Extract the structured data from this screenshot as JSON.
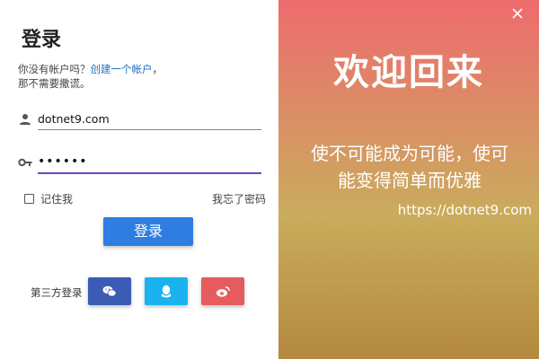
{
  "login": {
    "title": "登录",
    "hint_prefix": "你没有帐户吗？",
    "hint_link": "创建一个帐户",
    "hint_suffix": "，",
    "hint_line2": "那不需要撒谎。",
    "username_value": "dotnet9.com",
    "password_value": "••••••",
    "remember_label": "记住我",
    "forgot_label": "我忘了密码",
    "login_button": "登录",
    "third_party_label": "第三方登录",
    "social": [
      {
        "name": "wechat",
        "icon": "wechat-icon",
        "color": "#3b5bb5"
      },
      {
        "name": "qq",
        "icon": "qq-icon",
        "color": "#1ab3f0"
      },
      {
        "name": "weibo",
        "icon": "weibo-icon",
        "color": "#e55b5e"
      }
    ]
  },
  "welcome": {
    "heading": "欢迎回来",
    "slogan_line1": "使不可能成为可能，使可",
    "slogan_line2": "能变得简单而优雅",
    "url": "https://dotnet9.com"
  },
  "colors": {
    "accent": "#2f7de1",
    "link": "#1e6ec2",
    "focus_underline": "#6b46c1",
    "gradient_top": "#ee6b6e",
    "gradient_bottom": "#b4893f"
  },
  "icons": {
    "user_field": "user-icon",
    "password_field": "key-icon",
    "close": "close-icon"
  }
}
